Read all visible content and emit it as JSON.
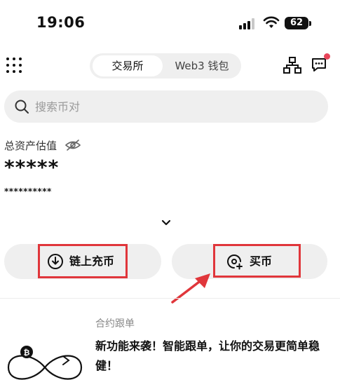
{
  "status_bar": {
    "time": "19:06",
    "battery": "62"
  },
  "header": {
    "tabs": [
      {
        "label": "交易所",
        "active": true
      },
      {
        "label": "Web3 钱包",
        "active": false
      }
    ],
    "notification_dot_color": "#e8455a"
  },
  "search": {
    "placeholder": "搜索币对"
  },
  "assets": {
    "label": "总资产估值",
    "value": "*****",
    "sub_value": "**********"
  },
  "actions": {
    "deposit_label": "链上充币",
    "buy_label": "买币",
    "highlight_color": "#e0363b"
  },
  "feature": {
    "tag": "合约跟单",
    "title": "新功能来袭！智能跟单，让你的交易更简单稳健！"
  }
}
